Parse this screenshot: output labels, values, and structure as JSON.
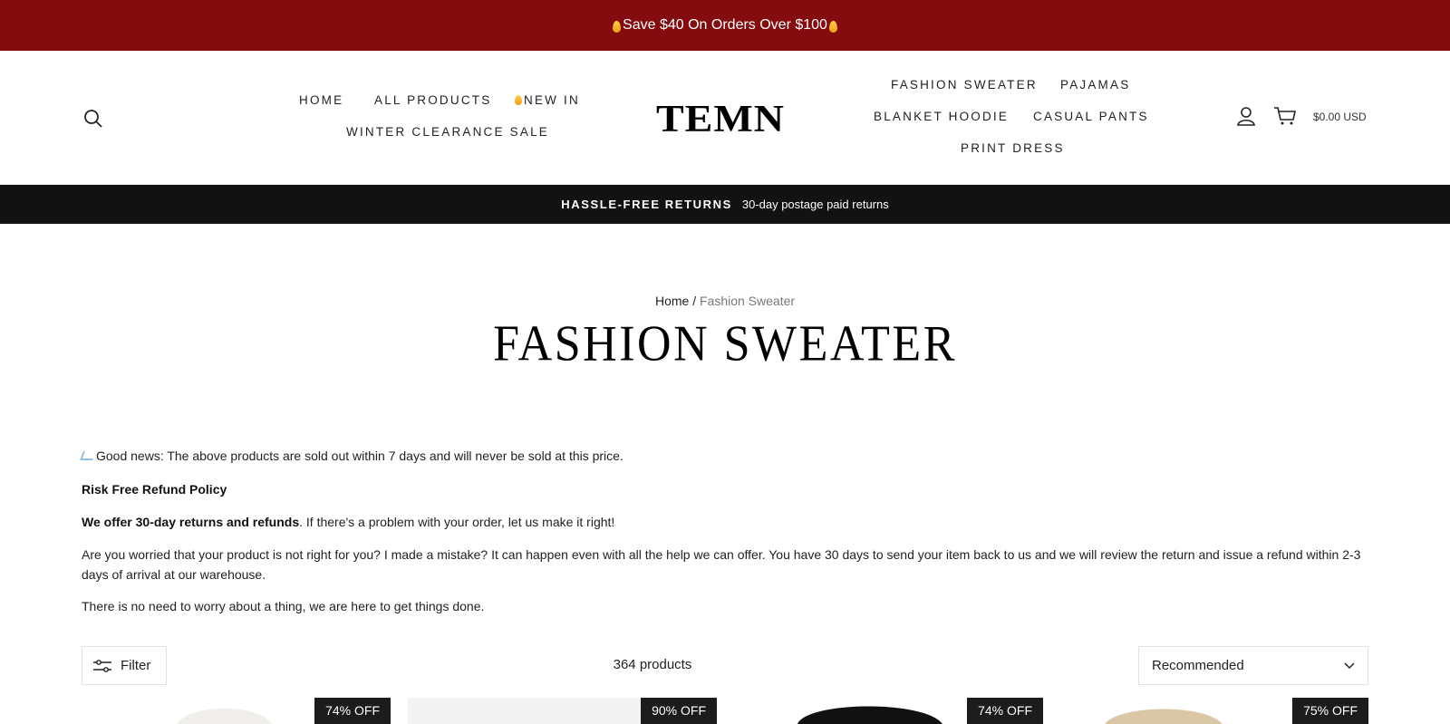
{
  "announcement": {
    "text": "Save $40 On Orders Over $100"
  },
  "nav": {
    "left": [
      "HOME",
      "ALL PRODUCTS",
      "NEW IN",
      "WINTER CLEARANCE SALE"
    ],
    "right": [
      "FASHION SWEATER",
      "PAJAMAS",
      "BLANKET HOODIE",
      "CASUAL PANTS",
      "PRINT DRESS"
    ]
  },
  "logo": "TEMN",
  "cart": {
    "total": "$0.00 USD"
  },
  "returns_bar": {
    "title": "HASSLE-FREE RETURNS",
    "text": "30-day postage paid returns"
  },
  "breadcrumb": {
    "home": "Home",
    "separator": "/",
    "current": "Fashion Sweater"
  },
  "page_title": "FASHION SWEATER",
  "description": {
    "p1": "Good news: The above products are sold out within 7 days and will never be sold at this price.",
    "p2": "Risk Free Refund Policy",
    "p3_bold": "We offer 30-day returns and refunds",
    "p3_rest": ". If there's a problem with your order, let us make it right!",
    "p4": "Are you worried that your product is not right for you? I made a mistake? It can happen even with all the help we can offer. You have 30 days to send your item back to us and we will review the return and issue a refund within 2-3 days of arrival at our warehouse.",
    "p5": "There is no need to worry about a thing, we are here to get things done."
  },
  "toolbar": {
    "filter_label": "Filter",
    "count": "364 products",
    "sort_value": "Recommended"
  },
  "products": [
    {
      "badge": "74% OFF"
    },
    {
      "badge": "90% OFF"
    },
    {
      "badge": "74% OFF"
    },
    {
      "badge": "75% OFF"
    }
  ],
  "colors": {
    "announcement_bg": "#840b0e",
    "returns_bar_bg": "#121212",
    "badge_bg": "#1c1c1c",
    "flame": "#f5a623"
  },
  "icons": [
    "flame-icon",
    "search-icon",
    "account-icon",
    "cart-icon",
    "filter-icon",
    "chevron-down-icon",
    "sparkle-icon"
  ]
}
